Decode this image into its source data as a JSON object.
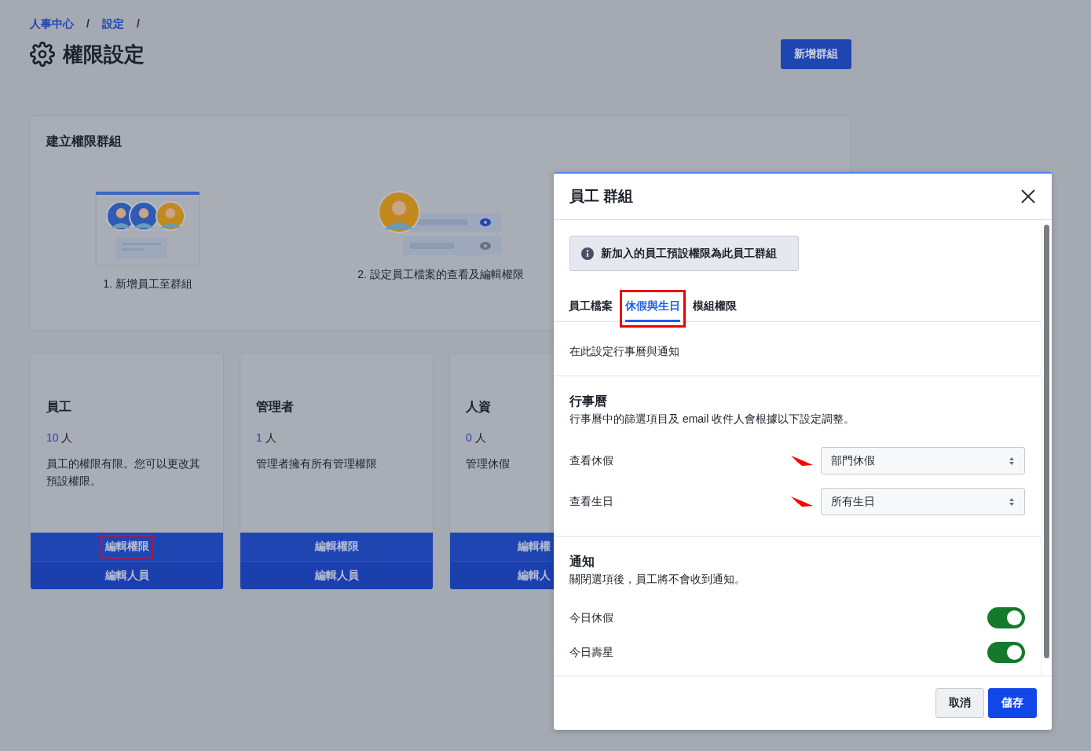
{
  "breadcrumb": [
    {
      "label": "人事中心",
      "separator": "/"
    },
    {
      "label": "設定",
      "separator": "/"
    }
  ],
  "page_title": "權限設定",
  "add_group_button": "新增群組",
  "create_card": {
    "title": "建立權限群組",
    "steps": [
      {
        "kind": "members",
        "label": "1. 新增員工至群組"
      },
      {
        "kind": "visibility",
        "label": "2. 設定員工檔案的查看及編輯權限"
      }
    ]
  },
  "groups": [
    {
      "name": "員工",
      "count": "10",
      "unit": "人",
      "description": "員工的權限有限。您可以更改其預設權限。",
      "clipped": false,
      "buttons": [
        {
          "label": "編輯權限",
          "annotated": true
        },
        {
          "label": "編輯人員",
          "annotated": false
        }
      ]
    },
    {
      "name": "管理者",
      "count": "1",
      "unit": "人",
      "description": "管理者擁有所有管理權限",
      "clipped": false,
      "buttons": [
        {
          "label": "編輯權限",
          "annotated": false
        },
        {
          "label": "編輯人員",
          "annotated": false
        }
      ]
    },
    {
      "name": "人資",
      "count": "0",
      "unit": "人",
      "description": "管理休假",
      "clipped": true,
      "buttons": [
        {
          "label": "編輯權",
          "annotated": false
        },
        {
          "label": "編輯人",
          "annotated": false
        }
      ]
    }
  ],
  "dialog": {
    "title": "員工 群組",
    "notice": "新加入的員工預設權限為此員工群組",
    "tabs": [
      {
        "label": "員工檔案",
        "selected": false,
        "annotated": false
      },
      {
        "label": "休假與生日",
        "selected": true,
        "annotated": true
      },
      {
        "label": "模組權限",
        "selected": false,
        "annotated": false
      }
    ],
    "intro": "在此設定行事曆與通知",
    "sections": [
      {
        "title": "行事曆",
        "description": "行事曆中的篩選項目及 email 收件人會根據以下設定調整。",
        "rows": [
          {
            "kind": "select",
            "label": "查看休假",
            "value": "部門休假",
            "annotated": true
          },
          {
            "kind": "select",
            "label": "查看生日",
            "value": "所有生日",
            "annotated": true
          }
        ]
      },
      {
        "title": "通知",
        "description": "關閉選項後，員工將不會收到通知。",
        "rows": [
          {
            "kind": "toggle",
            "label": "今日休假",
            "on": true
          },
          {
            "kind": "toggle",
            "label": "今日壽星",
            "on": true
          }
        ]
      }
    ],
    "buttons": [
      {
        "kind": "secondary",
        "label": "取消"
      },
      {
        "kind": "primary",
        "label": "儲存"
      }
    ]
  }
}
